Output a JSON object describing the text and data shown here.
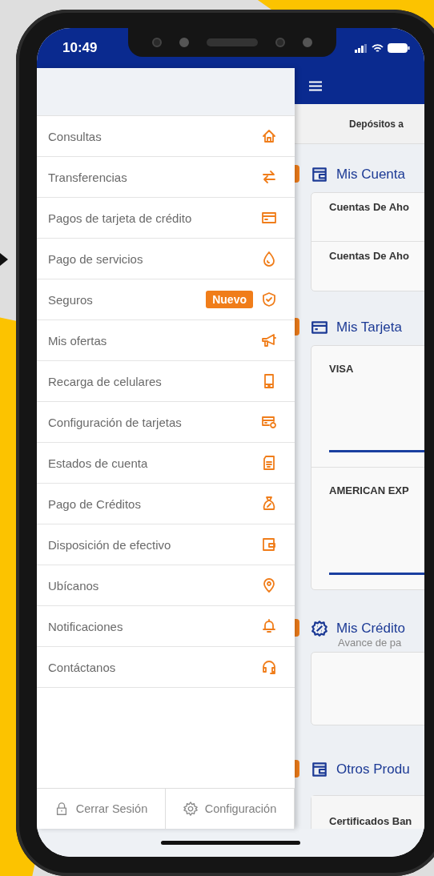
{
  "status_bar": {
    "time": "10:49"
  },
  "drawer": {
    "items": [
      {
        "label": "Consultas"
      },
      {
        "label": "Transferencias"
      },
      {
        "label": "Pagos de tarjeta de crédito"
      },
      {
        "label": "Pago de servicios"
      },
      {
        "label": "Seguros",
        "badge": "Nuevo"
      },
      {
        "label": "Mis ofertas"
      },
      {
        "label": "Recarga de celulares"
      },
      {
        "label": "Configuración de tarjetas"
      },
      {
        "label": "Estados de cuenta"
      },
      {
        "label": "Pago de Créditos"
      },
      {
        "label": "Disposición de efectivo"
      },
      {
        "label": "Ubícanos"
      },
      {
        "label": "Notificaciones"
      },
      {
        "label": "Contáctanos"
      }
    ],
    "footer": [
      {
        "label": "Cerrar Sesión"
      },
      {
        "label": "Configuración"
      }
    ]
  },
  "main": {
    "tab": "Depósitos a",
    "sections": [
      {
        "title": "Mis Cuenta",
        "rows": [
          {
            "kind": "account",
            "label": "Cuentas De Aho"
          },
          {
            "kind": "account",
            "label": "Cuentas De Aho"
          }
        ]
      },
      {
        "title": "Mis Tarjeta",
        "rows": [
          {
            "kind": "card",
            "label": "VISA"
          },
          {
            "kind": "card",
            "label": "AMERICAN EXP"
          }
        ]
      },
      {
        "title": "Mis Crédito",
        "subtitle": "Avance de pa"
      },
      {
        "title": "Otros Produ",
        "rows": [
          {
            "kind": "product",
            "label": "Certificados Ban"
          }
        ]
      }
    ]
  }
}
